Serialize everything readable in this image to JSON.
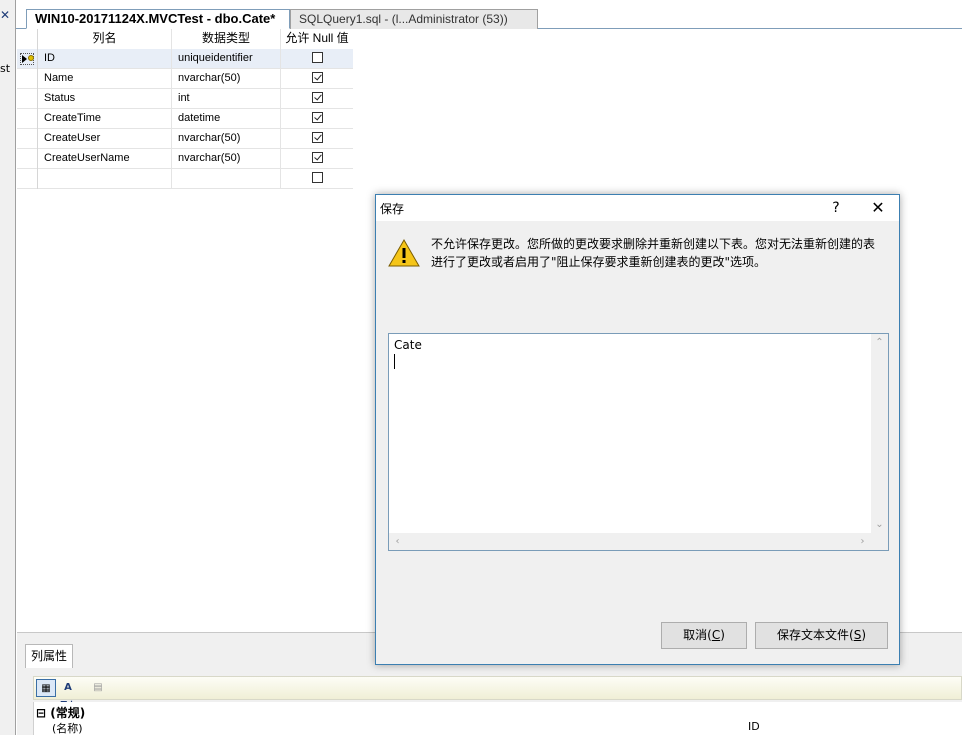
{
  "left_panel": {
    "close_glyph": "✕",
    "text_fragment": "st"
  },
  "tabs": [
    {
      "label": "WIN10-20171124X.MVCTest - dbo.Cate*",
      "active": true
    },
    {
      "label": "SQLQuery1.sql - (l...Administrator (53))",
      "active": false
    }
  ],
  "grid": {
    "headers": {
      "name": "列名",
      "type": "数据类型",
      "null": "允许 Null 值"
    },
    "rows": [
      {
        "name": "ID",
        "type": "uniqueidentifier",
        "allow_null": false,
        "primary_key": true
      },
      {
        "name": "Name",
        "type": "nvarchar(50)",
        "allow_null": true
      },
      {
        "name": "Status",
        "type": "int",
        "allow_null": true
      },
      {
        "name": "CreateTime",
        "type": "datetime",
        "allow_null": true
      },
      {
        "name": "CreateUser",
        "type": "nvarchar(50)",
        "allow_null": true
      },
      {
        "name": "CreateUserName",
        "type": "nvarchar(50)",
        "allow_null": true
      },
      {
        "name": "",
        "type": "",
        "allow_null": false
      }
    ]
  },
  "properties": {
    "tab_label": "列属性",
    "toolbar": {
      "alpha_glyph": "A Z↓"
    },
    "category": "⊟ (常规)",
    "name_label": "(名称)",
    "name_value": "ID"
  },
  "dialog": {
    "title": "保存",
    "help": "?",
    "close": "✕",
    "message": "不允许保存更改。您所做的更改要求删除并重新创建以下表。您对无法重新创建的表进行了更改或者启用了\"阻止保存要求重新创建表的更改\"选项。",
    "textarea_value": "Cate",
    "cancel_label": "取消",
    "cancel_hotkey": "C",
    "save_label": "保存文本文件",
    "save_hotkey": "S"
  },
  "colors": {
    "dialog_border": "#3c7fb1",
    "warning": "#f5c518"
  }
}
